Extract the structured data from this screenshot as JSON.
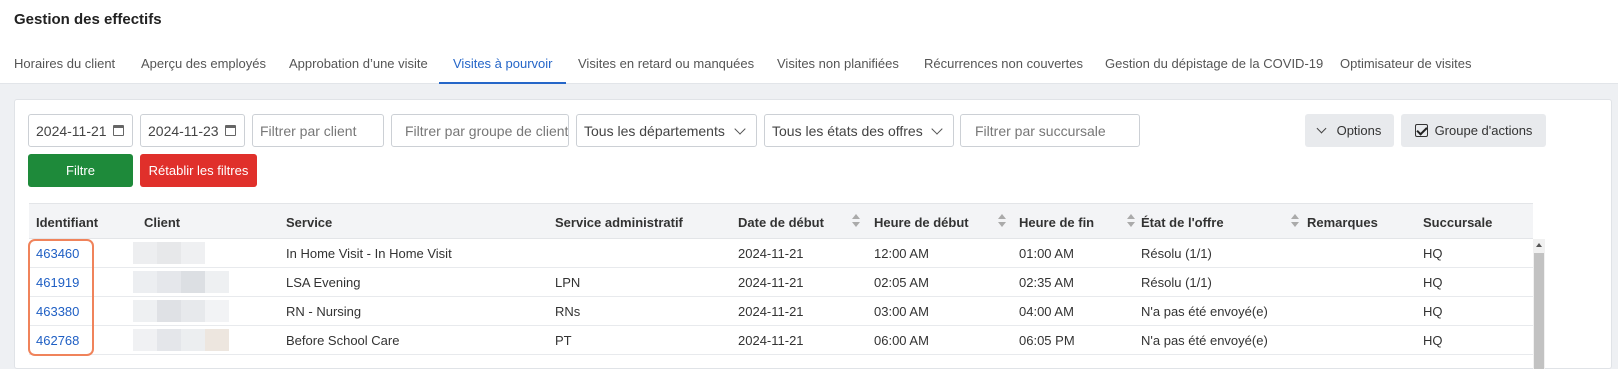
{
  "page": {
    "title": "Gestion des effectifs"
  },
  "tabs": [
    {
      "label": "Horaires du client",
      "active": false
    },
    {
      "label": "Aperçu des employés",
      "active": false
    },
    {
      "label": "Approbation d’une visite",
      "active": false
    },
    {
      "label": "Visites à pourvoir",
      "active": true
    },
    {
      "label": "Visites en retard ou manquées",
      "active": false
    },
    {
      "label": "Visites non planifiées",
      "active": false
    },
    {
      "label": "Récurrences non couvertes",
      "active": false
    },
    {
      "label": "Gestion du dépistage de la COVID-19",
      "active": false
    },
    {
      "label": "Optimisateur de visites",
      "active": false
    }
  ],
  "filters": {
    "start_date": "2024-11-21",
    "end_date": "2024-11-23",
    "client_placeholder": "Filtrer par client",
    "client_group_placeholder": "Filtrer par groupe de client",
    "department_selected": "Tous les départements",
    "offer_state_selected": "Tous les états des offres",
    "branch_placeholder": "Filtrer par succursale",
    "options_label": "Options",
    "action_group_label": "Groupe d'actions",
    "action_group_checked": true,
    "filter_button": "Filtre",
    "reset_button": "Rétablir les filtres"
  },
  "table": {
    "columns": [
      "Identifiant",
      "Client",
      "Service",
      "Service administratif",
      "Date de début",
      "Heure de début",
      "Heure de fin",
      "État de l'offre",
      "Remarques",
      "Succursale"
    ],
    "rows": [
      {
        "id": "463460",
        "service": "In Home Visit - In Home Visit",
        "admin_service": "",
        "start_date": "2024-11-21",
        "start_time": "12:00 AM",
        "end_time": "01:00 AM",
        "offer_state": "Résolu (1/1)",
        "remarks": "",
        "branch": "HQ"
      },
      {
        "id": "461919",
        "service": "LSA Evening",
        "admin_service": "LPN",
        "start_date": "2024-11-21",
        "start_time": "02:05 AM",
        "end_time": "02:35 AM",
        "offer_state": "Résolu (1/1)",
        "remarks": "",
        "branch": "HQ"
      },
      {
        "id": "463380",
        "service": "RN - Nursing",
        "admin_service": "RNs",
        "start_date": "2024-11-21",
        "start_time": "03:00 AM",
        "end_time": "04:00 AM",
        "offer_state": "N'a pas été envoyé(e)",
        "remarks": "",
        "branch": "HQ"
      },
      {
        "id": "462768",
        "service": "Before School Care",
        "admin_service": "PT",
        "start_date": "2024-11-21",
        "start_time": "06:00 AM",
        "end_time": "06:05 PM",
        "offer_state": "N'a pas été envoyé(e)",
        "remarks": "",
        "branch": "HQ"
      }
    ]
  },
  "colors": {
    "accent": "#2566c8",
    "filter_green": "#1e8a3a",
    "reset_red": "#e0302b",
    "highlight": "#f0835b"
  },
  "icons": [
    "calendar-icon",
    "chevron-down-icon",
    "checkbox-icon",
    "sort-icon"
  ]
}
